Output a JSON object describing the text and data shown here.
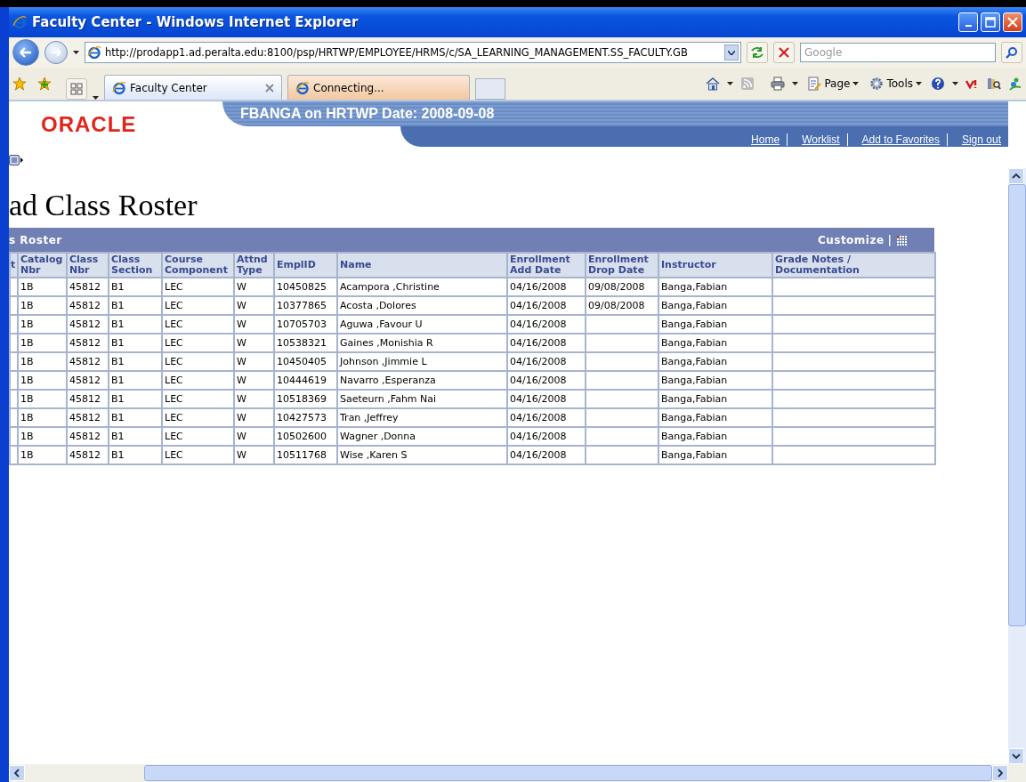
{
  "window": {
    "title": "Faculty Center - Windows Internet Explorer"
  },
  "address": {
    "url": "http://prodapp1.ad.peralta.edu:8100/psp/HRTWP/EMPLOYEE/HRMS/c/SA_LEARNING_MANAGEMENT.SS_FACULTY.GB"
  },
  "search": {
    "placeholder": "Google"
  },
  "tabs": [
    {
      "label": "Faculty Center",
      "selected": true
    },
    {
      "label": "Connecting...",
      "selected": false
    }
  ],
  "toolbar": [
    "Page",
    "Tools"
  ],
  "banner": {
    "logo": "ORACLE",
    "user_line": "FBANGA on HRTWP Date: 2008-09-08",
    "links": [
      "Home",
      "Worklist",
      "Add to Favorites",
      "Sign out"
    ]
  },
  "heading": "ad Class Roster",
  "grid": {
    "title": "s Roster",
    "customize": "Customize",
    "separator": "|",
    "columns": [
      "t",
      "Catalog Nbr",
      "Class Nbr",
      "Class Section",
      "Course Component",
      "Attnd Type",
      "EmplID",
      "Name",
      "Enrollment Add Date",
      "Enrollment Drop Date",
      "Instructor",
      "Grade Notes / Documentation"
    ],
    "rows": [
      [
        null,
        "1B",
        "45812",
        "B1",
        "LEC",
        "W",
        "10450825",
        "Acampora ,Christine",
        "04/16/2008",
        "09/08/2008",
        "Banga,Fabian",
        null
      ],
      [
        null,
        "1B",
        "45812",
        "B1",
        "LEC",
        "W",
        "10377865",
        "Acosta ,Dolores",
        "04/16/2008",
        "09/08/2008",
        "Banga,Fabian",
        null
      ],
      [
        null,
        "1B",
        "45812",
        "B1",
        "LEC",
        "W",
        "10705703",
        "Aguwa ,Favour U",
        "04/16/2008",
        null,
        "Banga,Fabian",
        null
      ],
      [
        null,
        "1B",
        "45812",
        "B1",
        "LEC",
        "W",
        "10538321",
        "Gaines ,Monishia R",
        "04/16/2008",
        null,
        "Banga,Fabian",
        null
      ],
      [
        null,
        "1B",
        "45812",
        "B1",
        "LEC",
        "W",
        "10450405",
        "Johnson ,Jimmie L",
        "04/16/2008",
        null,
        "Banga,Fabian",
        null
      ],
      [
        null,
        "1B",
        "45812",
        "B1",
        "LEC",
        "W",
        "10444619",
        "Navarro ,Esperanza",
        "04/16/2008",
        null,
        "Banga,Fabian",
        null
      ],
      [
        null,
        "1B",
        "45812",
        "B1",
        "LEC",
        "W",
        "10518369",
        "Saeteurn ,Fahm Nai",
        "04/16/2008",
        null,
        "Banga,Fabian",
        null
      ],
      [
        null,
        "1B",
        "45812",
        "B1",
        "LEC",
        "W",
        "10427573",
        "Tran ,Jeffrey",
        "04/16/2008",
        null,
        "Banga,Fabian",
        null
      ],
      [
        null,
        "1B",
        "45812",
        "B1",
        "LEC",
        "W",
        "10502600",
        "Wagner ,Donna",
        "04/16/2008",
        null,
        "Banga,Fabian",
        null
      ],
      [
        null,
        "1B",
        "45812",
        "B1",
        "LEC",
        "W",
        "10511768",
        "Wise ,Karen S",
        "04/16/2008",
        null,
        "Banga,Fabian",
        null
      ]
    ]
  }
}
